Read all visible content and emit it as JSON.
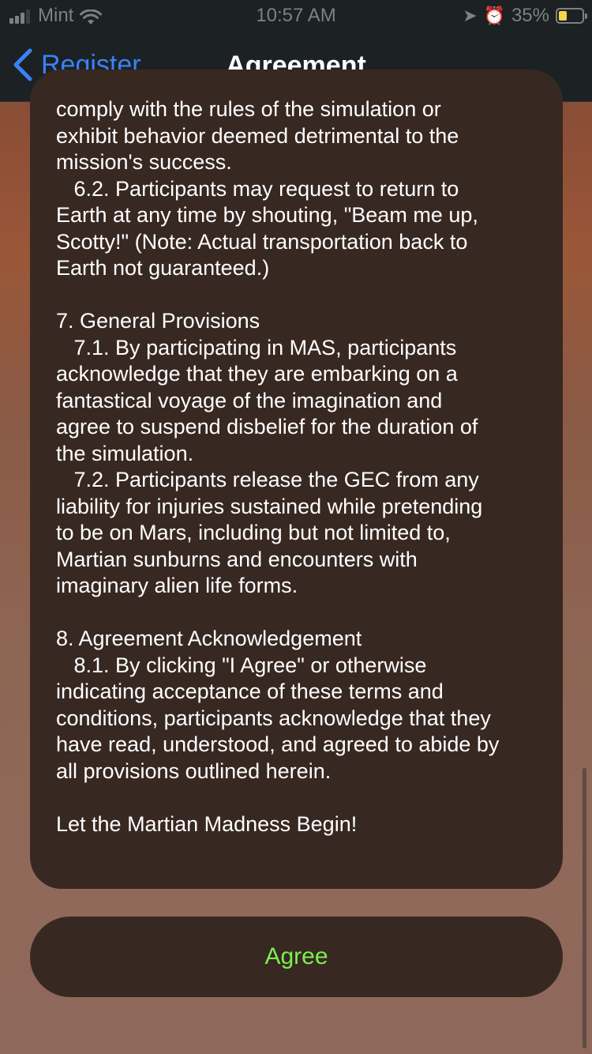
{
  "status_bar": {
    "carrier": "Mint",
    "time": "10:57 AM",
    "battery_percent": "35%",
    "battery_level": 0.35,
    "battery_color": "#f7d34a",
    "icons": [
      "signal-icon",
      "wifi-icon",
      "location-arrow-icon",
      "alarm-icon",
      "battery-icon"
    ]
  },
  "nav": {
    "back_label": "Register",
    "title": "Agreement",
    "accent_color": "#3b82f6"
  },
  "terms": {
    "text": "comply with the rules of the simulation or\nexhibit behavior deemed detrimental to the\nmission's success.\n   6.2. Participants may request to return to\nEarth at any time by shouting, \"Beam me up,\nScotty!\" (Note: Actual transportation back to\nEarth not guaranteed.)\n\n7. General Provisions\n   7.1. By participating in MAS, participants\nacknowledge that they are embarking on a\nfantastical voyage of the imagination and\nagree to suspend disbelief for the duration of\nthe simulation.\n   7.2. Participants release the GEC from any\nliability for injuries sustained while pretending\nto be on Mars, including but not limited to,\nMartian sunburns and encounters with\nimaginary alien life forms.\n\n8. Agreement Acknowledgement\n   8.1. By clicking \"I Agree\" or otherwise\nindicating acceptance of these terms and\nconditions, participants acknowledge that they\nhave read, understood, and agreed to abide by\nall provisions outlined herein.\n\nLet the Martian Madness Begin!"
  },
  "agree_button": {
    "label": "Agree",
    "label_color": "#7cef4e"
  }
}
